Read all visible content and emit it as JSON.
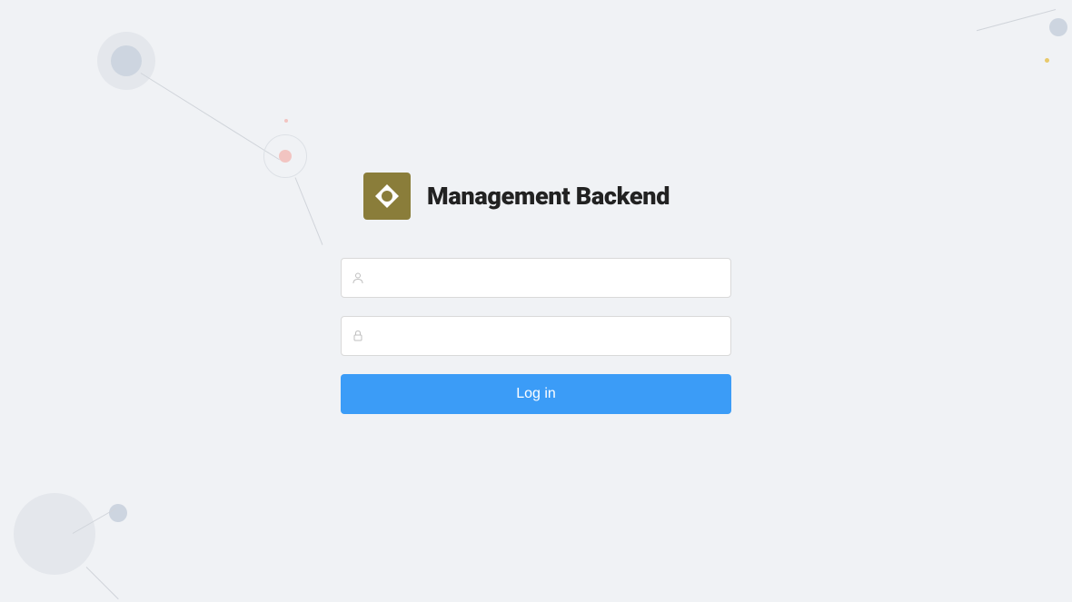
{
  "app": {
    "title": "Management Backend"
  },
  "login": {
    "username": {
      "value": "",
      "placeholder": ""
    },
    "password": {
      "value": "",
      "placeholder": ""
    },
    "button_label": "Log in"
  },
  "colors": {
    "background": "#f0f2f5",
    "logo_bg": "#8a7d3a",
    "primary_button": "#3b9cf7",
    "input_border": "#d9d9d9"
  }
}
